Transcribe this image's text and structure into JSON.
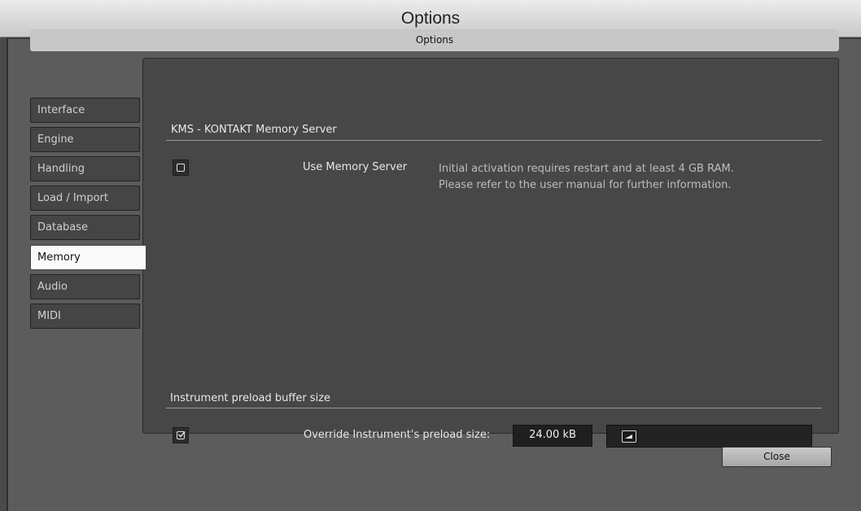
{
  "window": {
    "title": "Options"
  },
  "section_bar": {
    "label": "Options"
  },
  "tabs": [
    {
      "label": "Interface"
    },
    {
      "label": "Engine"
    },
    {
      "label": "Handling"
    },
    {
      "label": "Load / Import"
    },
    {
      "label": "Database"
    },
    {
      "label": "Memory",
      "active": true
    },
    {
      "label": "Audio"
    },
    {
      "label": "MIDI"
    }
  ],
  "kms": {
    "title": "KMS - KONTAKT Memory Server",
    "checkbox_checked": false,
    "label": "Use Memory Server",
    "note_line1": "Initial activation requires restart and at least 4 GB RAM.",
    "note_line2": "Please refer to the user manual for further information."
  },
  "preload": {
    "title": "Instrument preload buffer size",
    "checkbox_checked": true,
    "label": "Override Instrument's preload size:",
    "value": "24.00 kB",
    "slider_level": 0.0
  },
  "footer": {
    "close_label": "Close"
  },
  "colors": {
    "active_tab": "#fafafa",
    "panel": "#474747",
    "background": "#5c5c5c"
  }
}
